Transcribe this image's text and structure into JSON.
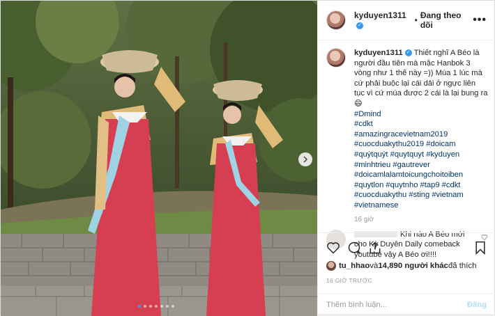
{
  "post": {
    "username": "kyduyen1311",
    "follow_separator": "•",
    "follow_label": "Đang theo dõi",
    "more_label": "•••",
    "caption_text": "Thiết nghĩ A Béo là người đầu tiên mà mặc Hanbok 3 vòng như 1 thế này =)) Múa 1 lúc mà cứ phải buộc lại cái dải ở ngực liên tục vì cứ múa được 2 cái là lại bung ra 😄",
    "hashtags": [
      "#Dmind",
      "#cdkt",
      "#amazingracevietnam2019",
      "#cuocduakythu2019 #doicam",
      "#quýtquýt #quytquyt #kyduyen",
      "#minhtrieu #gautrever",
      "#doicamlalamtoicungchoitoiben",
      "#quytlon #quytnho #tap9 #cdkt",
      "#cuocduakythu #sting #vietnam",
      "#vietnamese"
    ],
    "caption_time": "16 giờ",
    "comment_text": "Khi nào A Béo mới cho Kỳ Duyên Daily comeback youtube vậy A Béo ơi!!!!",
    "likes_user": "tu_hhao",
    "likes_mid": " và ",
    "likes_count": "14,890 người khác",
    "likes_suffix": " đã thích",
    "time_ago": "16 GIỜ TRƯỚC",
    "comment_placeholder": "Thêm bình luận...",
    "post_button": "Đăng"
  },
  "carousel": {
    "dot_count": 7,
    "active_index": 0
  },
  "icons": {
    "header_avatar": "avatar",
    "more": "more-icon",
    "like": "heart-icon",
    "comment": "comment-icon",
    "share": "share-icon",
    "save": "bookmark-icon",
    "next": "chevron-right-icon"
  },
  "colors": {
    "accent": "#3897f0",
    "hashtag": "#003569",
    "muted": "#999999",
    "post_button": "#b2dffc"
  }
}
